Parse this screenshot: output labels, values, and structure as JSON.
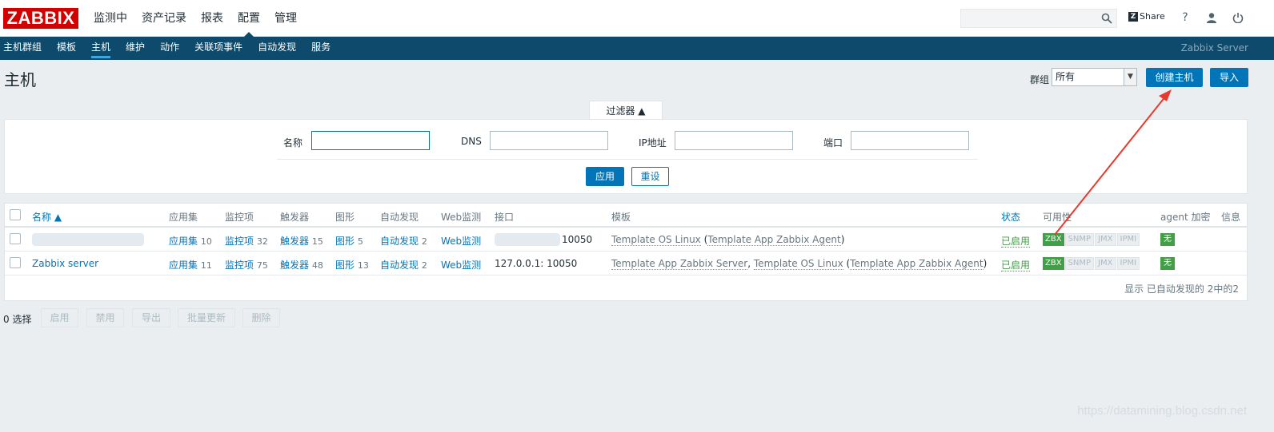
{
  "logo": "ZABBIX",
  "main_menu": [
    "监测中",
    "资产记录",
    "报表",
    "配置",
    "管理"
  ],
  "header": {
    "share": "Share",
    "share_badge": "Z",
    "help_icon": "?",
    "user_icon": "👤",
    "power_icon": "⏻"
  },
  "sub_menu": [
    "主机群组",
    "模板",
    "主机",
    "维护",
    "动作",
    "关联项事件",
    "自动发现",
    "服务"
  ],
  "server_name": "Zabbix Server",
  "page_title": "主机",
  "group": {
    "label": "群组",
    "selected": "所有"
  },
  "buttons": {
    "create_host": "创建主机",
    "import": "导入"
  },
  "filter": {
    "tab_label": "过滤器 ▲",
    "name_label": "名称",
    "dns_label": "DNS",
    "ip_label": "IP地址",
    "port_label": "端口",
    "apply": "应用",
    "reset": "重设"
  },
  "table": {
    "headers": {
      "name": "名称 ▲",
      "applications": "应用集",
      "items": "监控项",
      "triggers": "触发器",
      "graphs": "图形",
      "discovery": "自动发现",
      "web": "Web监测",
      "interface": "接口",
      "templates": "模板",
      "status": "状态",
      "availability": "可用性",
      "encryption": "agent 加密",
      "info": "信息"
    },
    "rows": [
      {
        "name": "",
        "applications": "应用集",
        "applications_count": "10",
        "items": "监控项",
        "items_count": "32",
        "triggers": "触发器",
        "triggers_count": "15",
        "graphs": "图形",
        "graphs_count": "5",
        "discovery": "自动发现",
        "discovery_count": "2",
        "web": "Web监测",
        "interface": "10050",
        "template_main": "Template OS Linux",
        "template_paren_open": " (",
        "template_sub": "Template App Zabbix Agent",
        "template_paren_close": ")",
        "status": "已启用",
        "avail": [
          "ZBX",
          "SNMP",
          "JMX",
          "IPMI"
        ],
        "encryption": "无"
      },
      {
        "name": "Zabbix server",
        "applications": "应用集",
        "applications_count": "11",
        "items": "监控项",
        "items_count": "75",
        "triggers": "触发器",
        "triggers_count": "48",
        "graphs": "图形",
        "graphs_count": "13",
        "discovery": "自动发现",
        "discovery_count": "2",
        "web": "Web监测",
        "interface": "127.0.0.1: 10050",
        "template_main": "Template App Zabbix Server",
        "template_sep": ", ",
        "template_main2": "Template OS Linux",
        "template_paren_open": " (",
        "template_sub": "Template App Zabbix Agent",
        "template_paren_close": ")",
        "status": "已启用",
        "avail": [
          "ZBX",
          "SNMP",
          "JMX",
          "IPMI"
        ],
        "encryption": "无"
      }
    ],
    "footer": "显示 已自动发现的 2中的2"
  },
  "actions": {
    "selected": "0 选择",
    "enable": "启用",
    "disable": "禁用",
    "export": "导出",
    "mass_update": "批量更新",
    "delete": "删除"
  },
  "watermark": "https://datamining.blog.csdn.net",
  "colors": {
    "brand": "#d40000",
    "nav": "#0e4a6b",
    "primary": "#0275b8",
    "ok": "#429e47",
    "arrow": "#e8392f"
  }
}
